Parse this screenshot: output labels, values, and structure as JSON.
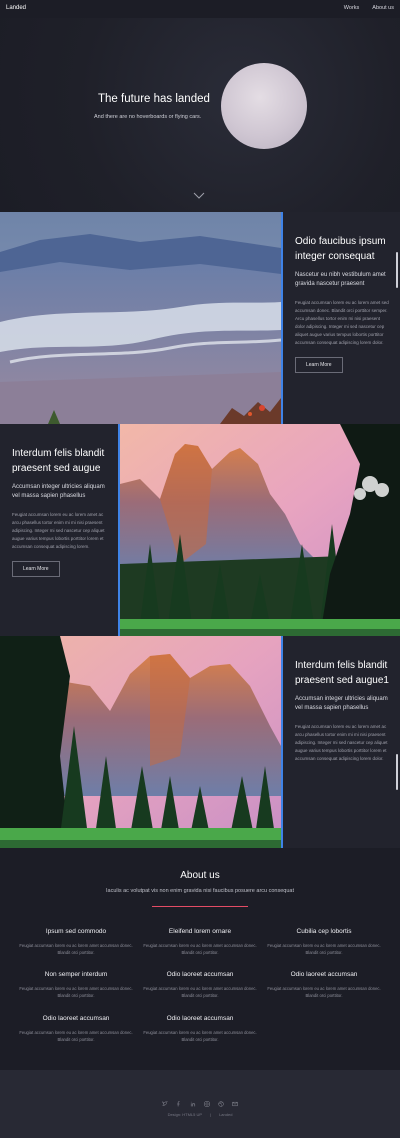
{
  "header": {
    "brand": "Landed",
    "nav": [
      "Works",
      "About us"
    ]
  },
  "hero": {
    "title": "The future has landed",
    "subtitle": "And there are no hoverboards or flying cars."
  },
  "spotlights": [
    {
      "title": "Odio faucibus ipsum integer consequat",
      "subtitle": "Nascetur eu nibh vestibulum amet gravida nascetur praesent",
      "body": "Feugiat accumsan lorem eu ac lorem amet sed accumsan donec. Blandit orci porttitor semper. Arcu phasellus tortor enim mi nisi praesent dolor adipiscing. Integer mi sed nascetur cep aliquet augue varius tempus lobortis porttitor accumsan consequat adipiscing lorem dolor.",
      "button": "Learn More"
    },
    {
      "title": "Interdum felis blandit praesent sed augue",
      "subtitle": "Accumsan integer ultricies aliquam vel massa sapien phasellus",
      "body": "Feugiat accumsan lorem eu ac lorem amet ac arcu phasellus tortor enim mi mi nisi praesent adipiscing. Integer mi sed nascetur cep aliquet augue varius tempus lobortis porttitor lorem et accumsan consequat adipiscing lorem.",
      "button": "Learn More"
    },
    {
      "title": "Interdum felis blandit praesent sed augue1",
      "subtitle": "Accumsan integer ultricies aliquam vel massa sapien phasellus",
      "body": "Feugiat accumsan lorem eu ac lorem amet ac arcu phasellus tortor enim mi mi nisi praesent adipiscing. Integer mi sed nascetur cep aliquet augue varius tempus lobortis porttitor lorem et accumsan consequat adipiscing lorem dolor."
    }
  ],
  "about": {
    "title": "About us",
    "subtitle": "Iaculis ac volutpat vis non enim gravida nisi faucibus posuere arcu consequat",
    "features": [
      {
        "title": "Ipsum sed commodo",
        "desc": "Feugiat accumsan lorem eu ac lorem amet accumsan donec. Blandit orci porttitor."
      },
      {
        "title": "Eleifend lorem ornare",
        "desc": "Feugiat accumsan lorem eu ac lorem amet accumsan donec. Blandit orci porttitor."
      },
      {
        "title": "Cubilia cep lobortis",
        "desc": "Feugiat accumsan lorem eu ac lorem amet accumsan donec. Blandit orci porttitor."
      },
      {
        "title": "Non semper interdum",
        "desc": "Feugiat accumsan lorem eu ac lorem amet accumsan donec. Blandit orci porttitor."
      },
      {
        "title": "Odio laoreet accumsan",
        "desc": "Feugiat accumsan lorem eu ac lorem amet accumsan donec. Blandit orci porttitor."
      },
      {
        "title": "Odio laoreet accumsan",
        "desc": "Feugiat accumsan lorem eu ac lorem amet accumsan donec. Blandit orci porttitor."
      },
      {
        "title": "Odio laoreet accumsan",
        "desc": "Feugiat accumsan lorem eu ac lorem amet accumsan donec. Blandit orci porttitor."
      },
      {
        "title": "Odio laoreet accumsan",
        "desc": "Feugiat accumsan lorem eu ac lorem amet accumsan donec. Blandit orci porttitor."
      }
    ]
  },
  "footer": {
    "icons": [
      "twitter-icon",
      "facebook-icon",
      "linkedin-icon",
      "instagram-icon",
      "dribbble-icon",
      "envelope-icon"
    ],
    "credit": "Design: HTML5 UP",
    "copyright": "Landed"
  },
  "colors": {
    "background": "#1c1d26",
    "accent_blue": "#3f83e7",
    "accent_pink": "#e44c65"
  }
}
